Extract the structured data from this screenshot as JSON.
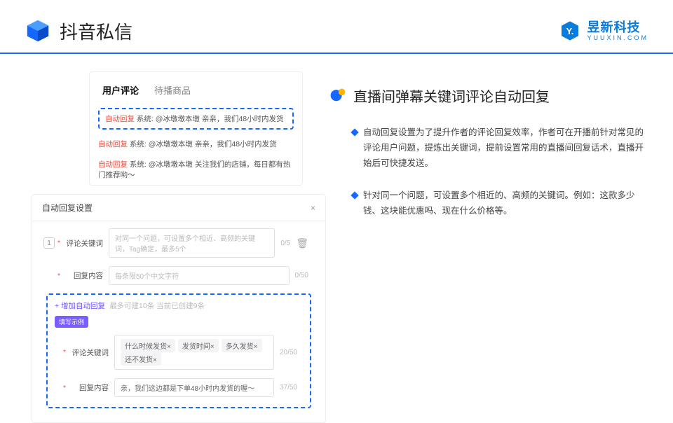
{
  "header": {
    "title": "抖音私信",
    "brand_cn": "昱新科技",
    "brand_en": "YUUXIN.COM"
  },
  "left": {
    "tabs": {
      "active": "用户评论",
      "inactive": "待播商品"
    },
    "replies": {
      "label": "自动回复",
      "prefix": "系统:",
      "user": "@冰墩墩本墩",
      "line1": "亲亲，我们48小时内发货",
      "line2": "亲亲，我们48小时内发货",
      "line3": "关注我们的店铺，每日都有热门推荐哟～"
    },
    "settings": {
      "title": "自动回复设置",
      "close": "×",
      "num": "1",
      "row1_label": "评论关键词",
      "row1_placeholder": "对同一个问题，可设置多个相近、高频的关键词，Tag确定，最多5个",
      "row1_counter": "0/5",
      "row2_label": "回复内容",
      "row2_placeholder": "每条限50个中文字符",
      "row2_counter": "0/50",
      "add_label": "+ 增加自动回复",
      "add_hint": "最多可建10条 当前已创建9条",
      "badge": "填写示例",
      "eg_label1": "评论关键词",
      "eg_tag1": "什么时候发货×",
      "eg_tag2": "发货时间×",
      "eg_tag3": "多久发货×",
      "eg_tag4": "还不发货×",
      "eg_counter1": "20/50",
      "eg_label2": "回复内容",
      "eg_value2": "亲，我们这边都是下单48小时内发货的喔～",
      "eg_counter2": "37/50",
      "trash": "🗑"
    }
  },
  "right": {
    "heading": "直播间弹幕关键词评论自动回复",
    "bullets": [
      "自动回复设置为了提升作者的评论回复效率，作者可在开播前针对常见的评论用户问题，提炼出关键词，提前设置常用的直播间回复话术，直播开始后可快捷发送。",
      "针对同一个问题，可设置多个相近的、高频的关键词。例如：这款多少钱、这块能优惠吗、现在什么价格等。"
    ]
  }
}
